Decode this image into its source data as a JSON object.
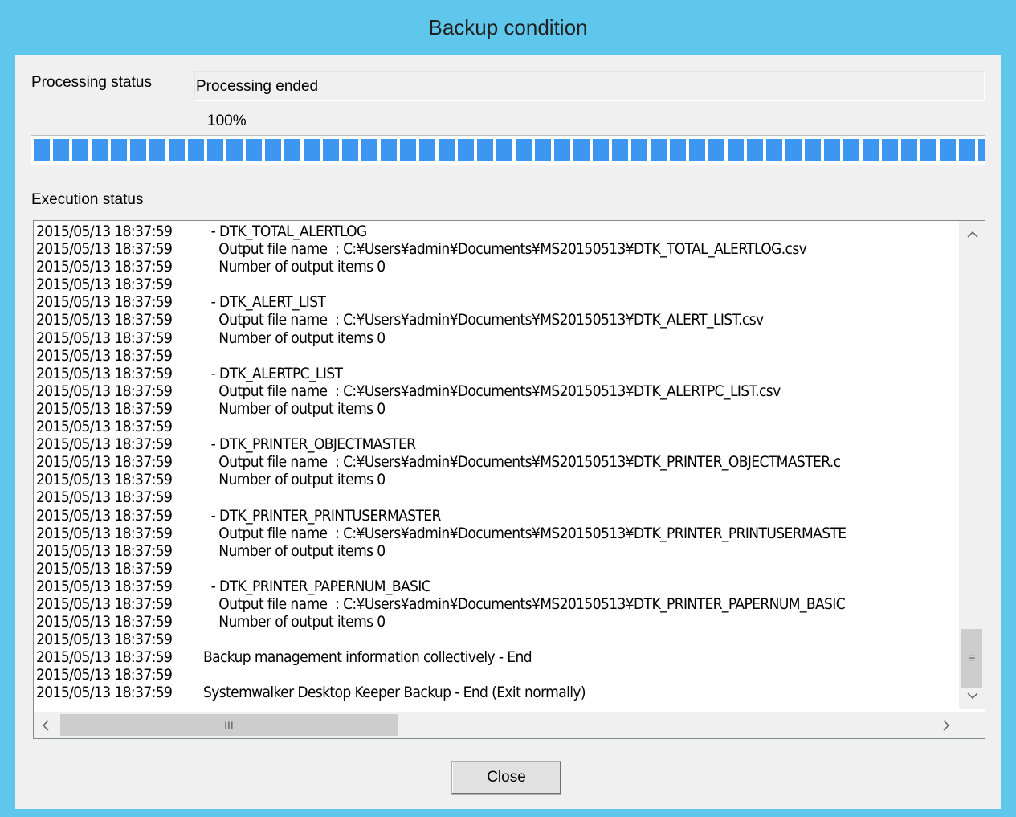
{
  "window": {
    "title": "Backup condition"
  },
  "processing": {
    "label": "Processing status",
    "status_value": "Processing ended",
    "percent_text": "100%",
    "progress": 1.0
  },
  "execution": {
    "label": "Execution status",
    "lines": [
      {
        "ts": "2015/05/13 18:37:59",
        "msg": "  - DTK_TOTAL_ALERTLOG"
      },
      {
        "ts": "2015/05/13 18:37:59",
        "msg": "    Output file name  : C:¥Users¥admin¥Documents¥MS20150513¥DTK_TOTAL_ALERTLOG.csv"
      },
      {
        "ts": "2015/05/13 18:37:59",
        "msg": "    Number of output items 0"
      },
      {
        "ts": "2015/05/13 18:37:59",
        "msg": ""
      },
      {
        "ts": "2015/05/13 18:37:59",
        "msg": "  - DTK_ALERT_LIST"
      },
      {
        "ts": "2015/05/13 18:37:59",
        "msg": "    Output file name  : C:¥Users¥admin¥Documents¥MS20150513¥DTK_ALERT_LIST.csv"
      },
      {
        "ts": "2015/05/13 18:37:59",
        "msg": "    Number of output items 0"
      },
      {
        "ts": "2015/05/13 18:37:59",
        "msg": ""
      },
      {
        "ts": "2015/05/13 18:37:59",
        "msg": "  - DTK_ALERTPC_LIST"
      },
      {
        "ts": "2015/05/13 18:37:59",
        "msg": "    Output file name  : C:¥Users¥admin¥Documents¥MS20150513¥DTK_ALERTPC_LIST.csv"
      },
      {
        "ts": "2015/05/13 18:37:59",
        "msg": "    Number of output items 0"
      },
      {
        "ts": "2015/05/13 18:37:59",
        "msg": ""
      },
      {
        "ts": "2015/05/13 18:37:59",
        "msg": "  - DTK_PRINTER_OBJECTMASTER"
      },
      {
        "ts": "2015/05/13 18:37:59",
        "msg": "    Output file name  : C:¥Users¥admin¥Documents¥MS20150513¥DTK_PRINTER_OBJECTMASTER.c"
      },
      {
        "ts": "2015/05/13 18:37:59",
        "msg": "    Number of output items 0"
      },
      {
        "ts": "2015/05/13 18:37:59",
        "msg": ""
      },
      {
        "ts": "2015/05/13 18:37:59",
        "msg": "  - DTK_PRINTER_PRINTUSERMASTER"
      },
      {
        "ts": "2015/05/13 18:37:59",
        "msg": "    Output file name  : C:¥Users¥admin¥Documents¥MS20150513¥DTK_PRINTER_PRINTUSERMASTE"
      },
      {
        "ts": "2015/05/13 18:37:59",
        "msg": "    Number of output items 0"
      },
      {
        "ts": "2015/05/13 18:37:59",
        "msg": ""
      },
      {
        "ts": "2015/05/13 18:37:59",
        "msg": "  - DTK_PRINTER_PAPERNUM_BASIC"
      },
      {
        "ts": "2015/05/13 18:37:59",
        "msg": "    Output file name  : C:¥Users¥admin¥Documents¥MS20150513¥DTK_PRINTER_PAPERNUM_BASIC"
      },
      {
        "ts": "2015/05/13 18:37:59",
        "msg": "    Number of output items 0"
      },
      {
        "ts": "2015/05/13 18:37:59",
        "msg": ""
      },
      {
        "ts": "2015/05/13 18:37:59",
        "msg": "Backup management information collectively - End"
      },
      {
        "ts": "2015/05/13 18:37:59",
        "msg": ""
      },
      {
        "ts": "2015/05/13 18:37:59",
        "msg": "Systemwalker Desktop Keeper Backup - End (Exit normally)"
      }
    ]
  },
  "scrollbars": {
    "up_icon": "chevron-up-icon",
    "down_icon": "chevron-down-icon",
    "left_icon": "chevron-left-icon",
    "right_icon": "chevron-right-icon",
    "v_grip": "≡",
    "h_grip": "III"
  },
  "buttons": {
    "close_label": "Close"
  },
  "colors": {
    "accent": "#5fc7eb",
    "progress_fill": "#3d96f0"
  }
}
